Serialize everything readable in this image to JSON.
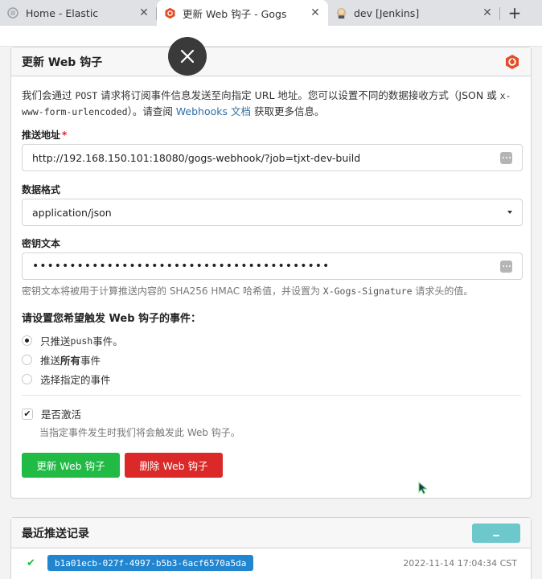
{
  "browser": {
    "tabs": [
      {
        "title": "Home - Elastic",
        "close": "✕"
      },
      {
        "title": "更新 Web 钩子 - Gogs",
        "close": "✕"
      },
      {
        "title": "dev [Jenkins]",
        "close": "✕"
      }
    ],
    "new_tab": "+"
  },
  "webhook": {
    "heading": "更新 Web 钩子",
    "intro": {
      "p1": "我们会通过 ",
      "post": "POST",
      "p2": " 请求将订阅事件信息发送至向指定 URL 地址。您可以设置不同的数据接收方式（JSON 或 ",
      "form": "x-www-form-urlencoded",
      "p3": "）。请查阅 ",
      "link": "Webhooks 文档",
      "p4": " 获取更多信息。"
    },
    "url_label": "推送地址",
    "required_mark": "*",
    "url_value": "http://192.168.150.101:18080/gogs-webhook/?job=tjxt-dev-build",
    "content_type_label": "数据格式",
    "content_type_value": "application/json",
    "secret_label": "密钥文本",
    "secret_value": "••••••••••••••••••••••••••••••••••••••••",
    "secret_help": {
      "p1": "密钥文本将被用于计算推送内容的 SHA256 HMAC 哈希值，并设置为 ",
      "header": "X-Gogs-Signature",
      "p2": " 请求头的值。"
    },
    "events_title": "请设置您希望触发 Web 钩子的事件：",
    "events": {
      "push_only_a": "只推送 ",
      "push_only_b": "push",
      "push_only_c": " 事件。",
      "all_a": "推送 ",
      "all_b": "所有",
      "all_c": " 事件",
      "choose": "选择指定的事件"
    },
    "active_label": "是否激活",
    "active_help": "当指定事件发生时我们将会触发此 Web 钩子。",
    "update_button": "更新 Web 钩子",
    "delete_button": "删除 Web 钩子"
  },
  "deliveries": {
    "heading": "最近推送记录",
    "records": [
      {
        "id": "b1a01ecb-027f-4997-b5b3-6acf6570a5da",
        "time": "2022-11-14 17:04:34 CST"
      }
    ]
  },
  "colors": {
    "green": "#21ba45",
    "red": "#db2828",
    "blue": "#2185d0",
    "teal": "#6dc8cc"
  }
}
